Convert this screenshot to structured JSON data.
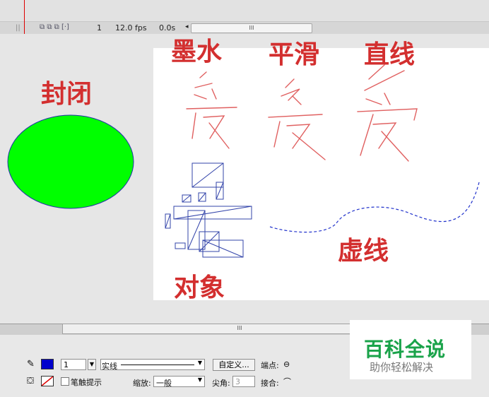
{
  "timeline": {
    "frame": "1",
    "fps": "12.0 fps",
    "time": "0.0s",
    "scroll_grip": "III"
  },
  "stage_labels": {
    "closed": "封闭",
    "ink": "墨水",
    "smooth": "平滑",
    "straight": "直线",
    "object": "对象",
    "dashed": "虚线"
  },
  "colors": {
    "label_red": "#d32f2f",
    "fill_green": "#00ff00",
    "stroke_blue": "#2233aa"
  },
  "bottom_scroll": {
    "grip": "III"
  },
  "properties": {
    "stroke_width": "1",
    "stroke_style": "实线",
    "custom_button": "自定义...",
    "cap_label": "端点:",
    "stroke_hint": "笔触提示",
    "scale_label": "缩放:",
    "scale_value": "一般",
    "miter_label": "尖角:",
    "miter_value": "3",
    "join_label": "接合:"
  },
  "watermark": {
    "title": "百科全说",
    "subtitle": "助你轻松解决"
  },
  "icons": [
    "pencil-icon",
    "paint-bucket-icon",
    "stroke-color-swatch",
    "fill-color-swatch",
    "cap-icon",
    "join-icon",
    "onion-skin-icons",
    "dropdown-arrow-icon"
  ]
}
